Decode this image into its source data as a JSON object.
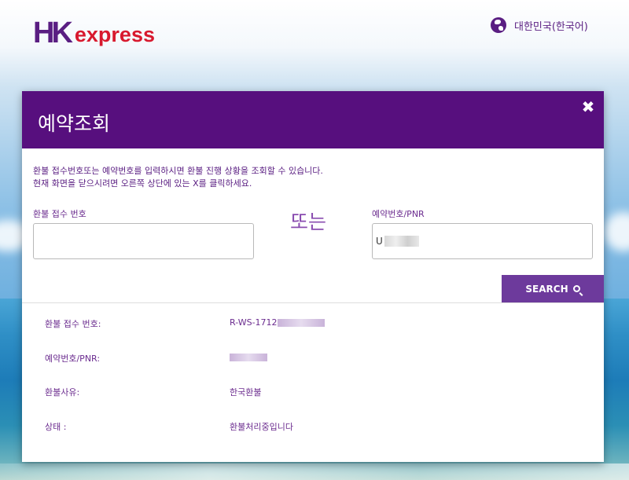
{
  "brand": {
    "logo_hk": "HK",
    "logo_express": "express",
    "purple": "#570f7e",
    "red": "#d8192e"
  },
  "language": {
    "icon": "globe-icon",
    "label": "대한민국(한국어)"
  },
  "modal": {
    "title": "예약조회",
    "close_label": "✖",
    "info_line1": "환불 접수번호또는 예약번호를 입력하시면 환불 진행 상황을 조회할 수 있습니다.",
    "info_line2": "현재 화면을 닫으시려면 오른쪽 상단에 있는 X를 클릭하세요.",
    "refund_number_label": "환불 접수 번호",
    "refund_number_value": "",
    "or_text": "또는",
    "pnr_label": "예약번호/PNR",
    "pnr_value": "U",
    "search_label": "SEARCH",
    "search_icon": "search-icon"
  },
  "results": [
    {
      "label": "환불 접수 번호:",
      "value": "R-WS-1712"
    },
    {
      "label": "예약번호/PNR:",
      "value": ""
    },
    {
      "label": "환불사유:",
      "value": "한국환불"
    },
    {
      "label": "상태 :",
      "value": "환불처리중입니다"
    }
  ]
}
